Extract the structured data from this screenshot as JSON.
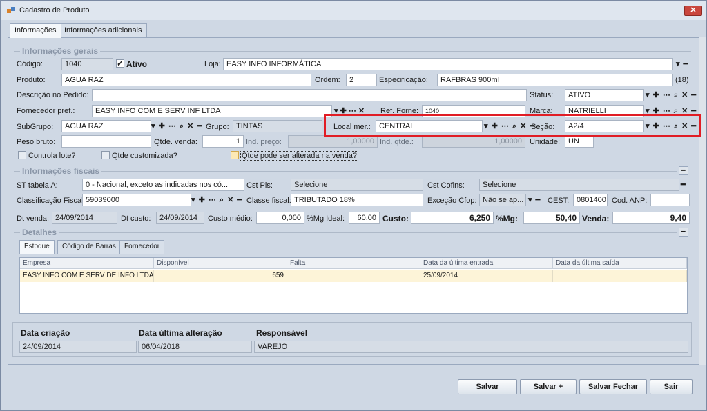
{
  "window": {
    "title": "Cadastro de Produto",
    "close": "✕"
  },
  "tabs": [
    "Informações",
    "Informações adicionais"
  ],
  "gerais": {
    "section_title": "Informações gerais",
    "codigo_label": "Código:",
    "codigo": "1040",
    "ativo_label": "Ativo",
    "ativo_check": "✓",
    "loja_label": "Loja:",
    "loja": "EASY INFO INFORMÁTICA",
    "produto_label": "Produto:",
    "produto": "AGUA RAZ",
    "ordem_label": "Ordem:",
    "ordem": "2",
    "especificacao_label": "Especificação:",
    "especificacao": "RAFBRAS 900ml",
    "espec_count": "(18)",
    "descricao_label": "Descrição no Pedido:",
    "descricao": "",
    "status_label": "Status:",
    "status": "ATIVO",
    "fornecedor_label": "Fornecedor pref.:",
    "fornecedor": "EASY INFO COM E SERV INF LTDA",
    "ref_forne_label": "Ref. Forne:",
    "ref_forne": "1040",
    "marca_label": "Marca:",
    "marca": "NATRIELLI",
    "subgrupo_label": "SubGrupo:",
    "subgrupo": "AGUA RAZ",
    "grupo_label": "Grupo:",
    "grupo": "TINTAS",
    "local_label": "Local mer.:",
    "local": "CENTRAL",
    "secao_label": "Seção:",
    "secao": "A2/4",
    "peso_label": "Peso bruto:",
    "peso": "",
    "qtde_venda_label": "Qtde. venda:",
    "qtde_venda": "1",
    "ind_preco_label": "Ind. preço:",
    "ind_preco": "1,00000",
    "ind_qtde_label": "Ind. qtde.:",
    "ind_qtde": "1,00000",
    "unidade_label": "Unidade:",
    "unidade": "UN",
    "controla_lote": "Controla lote?",
    "qtde_customizada": "Qtde customizada?",
    "qtde_alterada": "Qtde pode ser alterada na venda?"
  },
  "lookup_buttons": "▾ ✚ ⋯ ⌕ ✕ ━",
  "fiscais": {
    "section_title": "Informações fiscais",
    "st_label": "ST tabela A:",
    "st": "0 - Nacional, exceto as indicadas nos có...",
    "cst_pis_label": "Cst Pis:",
    "cst_pis": "Selecione",
    "cst_cofins_label": "Cst Cofins:",
    "cst_cofins": "Selecione",
    "classificacao_label": "Classificação Fiscal:",
    "classificacao": "59039000",
    "classe_label": "Classe fiscal:",
    "classe": "TRIBUTADO 18%",
    "excecao_label": "Exceção Cfop:",
    "excecao": "Não se ap...",
    "cest_label": "CEST:",
    "cest": "0801400",
    "anp_label": "Cod. ANP:",
    "anp": ""
  },
  "valores": {
    "dt_venda_label": "Dt venda:",
    "dt_venda": "24/09/2014",
    "dt_custo_label": "Dt custo:",
    "dt_custo": "24/09/2014",
    "custo_medio_label": "Custo médio:",
    "custo_medio": "0,000",
    "mg_ideal_label": "%Mg Ideal:",
    "mg_ideal": "60,00",
    "custo_label": "Custo:",
    "custo": "6,250",
    "mg_label": "%Mg:",
    "mg": "50,40",
    "venda_label": "Venda:",
    "venda": "9,40"
  },
  "detalhes": {
    "section_title": "Detalhes",
    "tabs": [
      "Estoque",
      "Código de Barras",
      "Fornecedor"
    ],
    "columns": [
      "Empresa",
      "Disponível",
      "Falta",
      "Data da última entrada",
      "Data da última saída"
    ],
    "rows": [
      [
        "EASY INFO COM E SERV DE INFO LTDA",
        "659",
        "",
        "25/09/2014",
        ""
      ]
    ]
  },
  "footer": {
    "data_criacao_label": "Data criação",
    "data_criacao": "24/09/2014",
    "data_alteracao_label": "Data última alteração",
    "data_alteracao": "06/04/2018",
    "responsavel_label": "Responsável",
    "responsavel": "VAREJO"
  },
  "buttons": {
    "salvar": "Salvar",
    "salvar_mais": "Salvar +",
    "salvar_fechar": "Salvar Fechar",
    "sair": "Sair"
  },
  "colors": {
    "highlight": "#e11d25",
    "row_selected": "#fdf4d8"
  }
}
